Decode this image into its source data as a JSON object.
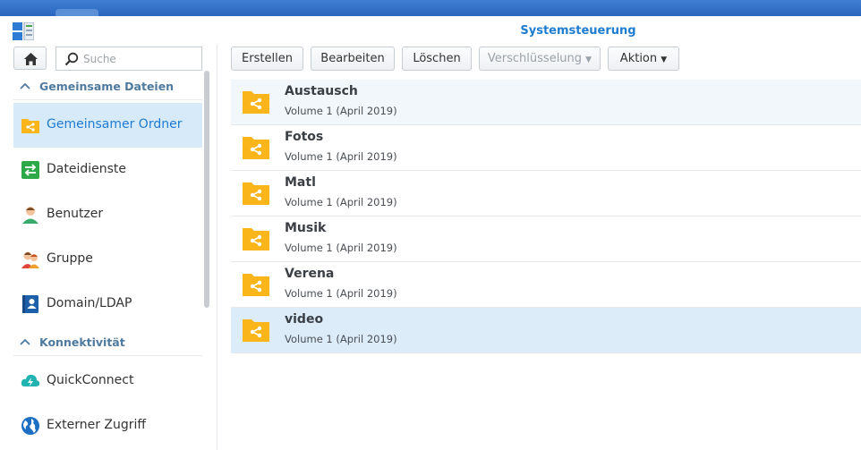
{
  "window": {
    "title": "Systemsteuerung"
  },
  "search": {
    "placeholder": "Suche"
  },
  "sidebar": {
    "sections": [
      {
        "label": "Gemeinsame Dateien"
      },
      {
        "label": "Konnektivität"
      }
    ],
    "items": [
      {
        "label": "Gemeinsamer Ordner",
        "icon": "shared-folder-icon"
      },
      {
        "label": "Dateidienste",
        "icon": "file-services-icon"
      },
      {
        "label": "Benutzer",
        "icon": "user-icon"
      },
      {
        "label": "Gruppe",
        "icon": "group-icon"
      },
      {
        "label": "Domain/LDAP",
        "icon": "domain-ldap-icon"
      },
      {
        "label": "QuickConnect",
        "icon": "quickconnect-icon"
      },
      {
        "label": "Externer Zugriff",
        "icon": "globe-icon"
      }
    ]
  },
  "toolbar": {
    "create": "Erstellen",
    "edit": "Bearbeiten",
    "delete": "Löschen",
    "encryption": "Verschlüsselung",
    "action": "Aktion"
  },
  "folders": [
    {
      "name": "Austausch",
      "location": "Volume 1 (April 2019)"
    },
    {
      "name": "Fotos",
      "location": "Volume 1 (April 2019)"
    },
    {
      "name": "Matl",
      "location": "Volume 1 (April 2019)"
    },
    {
      "name": "Musik",
      "location": "Volume 1 (April 2019)"
    },
    {
      "name": "Verena",
      "location": "Volume 1 (April 2019)"
    },
    {
      "name": "video",
      "location": "Volume 1 (April 2019)"
    }
  ],
  "colors": {
    "accent": "#1f7ccf",
    "folder": "#f9b51a",
    "selection": "#dcecf9"
  }
}
